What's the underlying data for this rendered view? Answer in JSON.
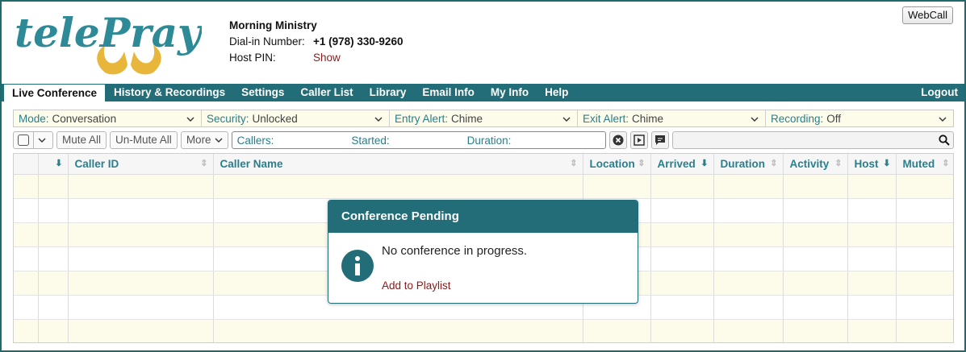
{
  "header": {
    "logo_text": "telePray",
    "conference_name": "Morning Ministry",
    "dial_in_label": "Dial-in Number:",
    "dial_in_value": "+1 (978) 330-9260",
    "host_pin_label": "Host PIN:",
    "host_pin_action": "Show",
    "webcall_label": "WebCall"
  },
  "nav": {
    "tabs": [
      {
        "label": "Live Conference",
        "active": true
      },
      {
        "label": "History & Recordings"
      },
      {
        "label": "Settings"
      },
      {
        "label": "Caller List"
      },
      {
        "label": "Library"
      },
      {
        "label": "Email Info"
      },
      {
        "label": "My Info"
      },
      {
        "label": "Help"
      }
    ],
    "logout": "Logout"
  },
  "settings": [
    {
      "key": "Mode:",
      "value": "Conversation"
    },
    {
      "key": "Security:",
      "value": "Unlocked"
    },
    {
      "key": "Entry Alert:",
      "value": "Chime"
    },
    {
      "key": "Exit Alert:",
      "value": "Chime"
    },
    {
      "key": "Recording:",
      "value": "Off"
    }
  ],
  "toolbar": {
    "mute_all": "Mute All",
    "unmute_all": "Un-Mute All",
    "more": "More",
    "callers_label": "Callers:",
    "started_label": "Started:",
    "duration_label": "Duration:"
  },
  "table": {
    "columns": [
      "",
      "",
      "Caller ID",
      "Caller Name",
      "Location",
      "Arrived",
      "Duration",
      "Activity",
      "Host",
      "Muted"
    ]
  },
  "modal": {
    "title": "Conference Pending",
    "message": "No conference in progress.",
    "link": "Add to Playlist"
  },
  "colors": {
    "brand_teal": "#236d78",
    "accent_text": "#2a7f8c",
    "link_red": "#8b1a1a",
    "row_yellow": "#fdfbea",
    "logo_gold": "#e8b63a"
  }
}
